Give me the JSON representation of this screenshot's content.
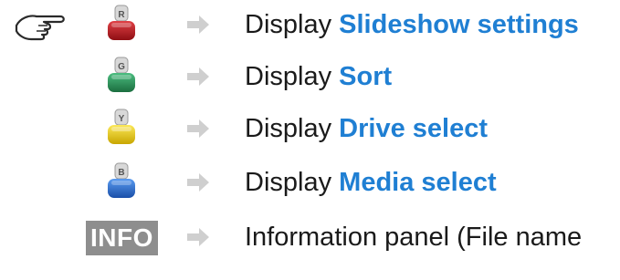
{
  "rows": [
    {
      "key": "R",
      "key_color": "#c8161d",
      "prefix": "Display",
      "highlight": "Slideshow settings"
    },
    {
      "key": "G",
      "key_color": "#2e9a5e",
      "prefix": "Display",
      "highlight": "Sort"
    },
    {
      "key": "Y",
      "key_color": "#e8cc10",
      "prefix": "Display",
      "highlight": "Drive select"
    },
    {
      "key": "B",
      "key_color": "#2a6fd8",
      "prefix": "Display",
      "highlight": "Media select"
    }
  ],
  "info": {
    "key_label": "INFO",
    "description": "Information panel (File name"
  },
  "colors": {
    "highlight_text": "#1f7fd3",
    "arrow": "#cfcfcf",
    "info_key_bg": "#8e8e8e"
  },
  "icons": {
    "pointer": "pointing-hand-icon",
    "arrow": "right-arrow-icon"
  }
}
